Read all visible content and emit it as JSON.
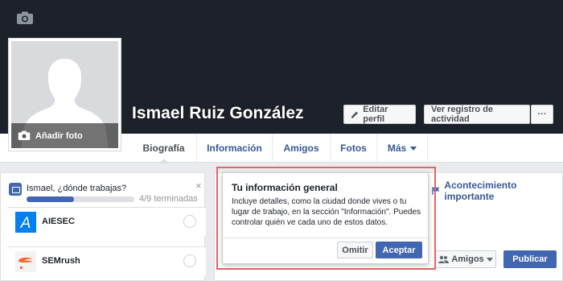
{
  "profile": {
    "name": "Ismael Ruiz González",
    "add_photo_label": "Añadir foto"
  },
  "header_actions": {
    "edit_profile": "Editar perfil",
    "activity_log": "Ver registro de actividad",
    "more": "···"
  },
  "tabs": [
    {
      "label": "Biografía",
      "active": true
    },
    {
      "label": "Información",
      "active": false
    },
    {
      "label": "Amigos",
      "active": false
    },
    {
      "label": "Fotos",
      "active": false
    },
    {
      "label": "Más",
      "active": false
    }
  ],
  "work_prompt": {
    "question": "Ismael, ¿dónde trabajas?",
    "progress_text": "4/9 terminadas",
    "progress_fraction": 0.44,
    "close": "×",
    "options": [
      {
        "name": "AIESEC",
        "logo_letter": "A"
      },
      {
        "name": "SEMrush",
        "logo_letter": ""
      }
    ]
  },
  "composer": {
    "life_event": "Acontecimiento importante",
    "audience": "Amigos",
    "publish": "Publicar"
  },
  "popover": {
    "title": "Tu información general",
    "body": "Incluye detalles, como la ciudad donde vives o tu lugar de trabajo, en la sección \"Información\". Puedes controlar quién ve cada uno de estos datos.",
    "skip": "Omitir",
    "accept": "Aceptar"
  },
  "colors": {
    "cover": "#1d2129",
    "brand_blue": "#4267b2",
    "link_blue": "#365899",
    "highlight": "#e36467",
    "aiesec_blue": "#037ef3",
    "semrush_orange": "#ff642d"
  },
  "icons": [
    "camera-icon",
    "pencil-icon",
    "briefcase-icon",
    "flag-icon",
    "friends-icon",
    "chevron-down-icon"
  ]
}
